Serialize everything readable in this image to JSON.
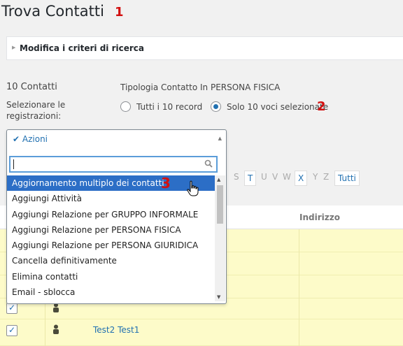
{
  "page": {
    "title": "Trova Contatti"
  },
  "badges": {
    "b1": "1",
    "b2": "2",
    "b3": "3"
  },
  "criteria": {
    "label": "Modifica i criteri di ricerca"
  },
  "summary": {
    "count": "10 Contatti",
    "filter": "Tipologia Contatto In PERSONA FISICA",
    "select_label_line1": "Selezionare le",
    "select_label_line2": "registrazioni:",
    "radio_all": "Tutti i 10 record",
    "radio_selected": "Solo 10 voci selezionate"
  },
  "actions": {
    "label": "Azioni",
    "search_value": "",
    "options": [
      "Aggiornamento multiplo dei contatti",
      "Aggiungi Attività",
      "Aggiungi Relazione per GRUPPO INFORMALE",
      "Aggiungi Relazione per PERSONA FISICA",
      "Aggiungi Relazione per PERSONA GIURIDICA",
      "Cancella definitivamente",
      "Elimina contatti",
      "Email - sblocca"
    ]
  },
  "alphabet": {
    "letters": [
      "S",
      "T",
      "U",
      "V",
      "W",
      "X",
      "Y",
      "Z"
    ],
    "all_label": "Tutti"
  },
  "table": {
    "address_header": "Indirizzo",
    "last_row_name": "Test2 Test1"
  },
  "colors": {
    "accent": "#2271b1",
    "highlight": "#2c6ec6",
    "row_bg": "#fdfbc9",
    "badge": "#d21010"
  }
}
